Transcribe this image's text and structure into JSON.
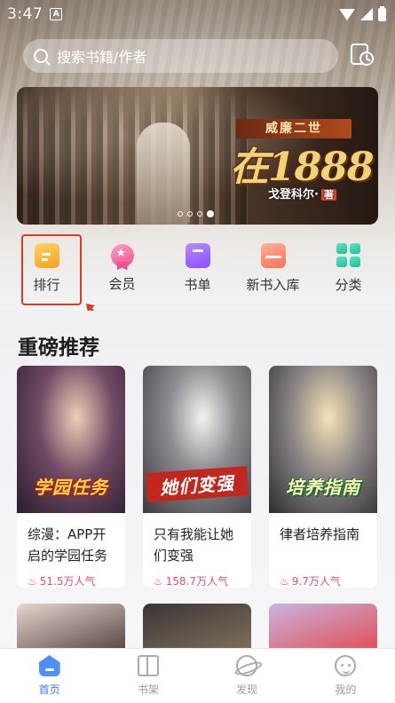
{
  "status_bar": {
    "time": "3:47",
    "notification_icon": "A"
  },
  "search": {
    "placeholder": "搜索书籍/作者"
  },
  "banner": {
    "subtitle": "威廉二世",
    "title": "在1888",
    "author": "戈登科尔·",
    "author_badge": "著",
    "dots_total": 4,
    "dots_active_index": 3
  },
  "quick_nav": [
    {
      "id": "rank",
      "label": "排行"
    },
    {
      "id": "member",
      "label": "会员"
    },
    {
      "id": "booklist",
      "label": "书单"
    },
    {
      "id": "new",
      "label": "新书入库"
    },
    {
      "id": "category",
      "label": "分类"
    }
  ],
  "recommend": {
    "title": "重磅推荐",
    "books": [
      {
        "name": "综漫：APP开启的学园任务",
        "heat": "51.5万人气",
        "cover_text": "学园任务"
      },
      {
        "name": "只有我能让她们变强",
        "heat": "158.7万人气",
        "cover_text": "她们变强"
      },
      {
        "name": "律者培养指南",
        "heat": "9.7万人气",
        "cover_text": "培养指南"
      }
    ]
  },
  "bottom_nav": [
    {
      "id": "home",
      "label": "首页",
      "icon": "home-icon",
      "active": true
    },
    {
      "id": "shelf",
      "label": "书架",
      "icon": "bookshelf-icon",
      "active": false
    },
    {
      "id": "discover",
      "label": "发现",
      "icon": "planet-icon",
      "active": false
    },
    {
      "id": "mine",
      "label": "我的",
      "icon": "smiley-icon",
      "active": false
    }
  ],
  "colors": {
    "accent": "#3a7df2",
    "heat": "#ef4c6c",
    "highlight": "#e0391f"
  }
}
